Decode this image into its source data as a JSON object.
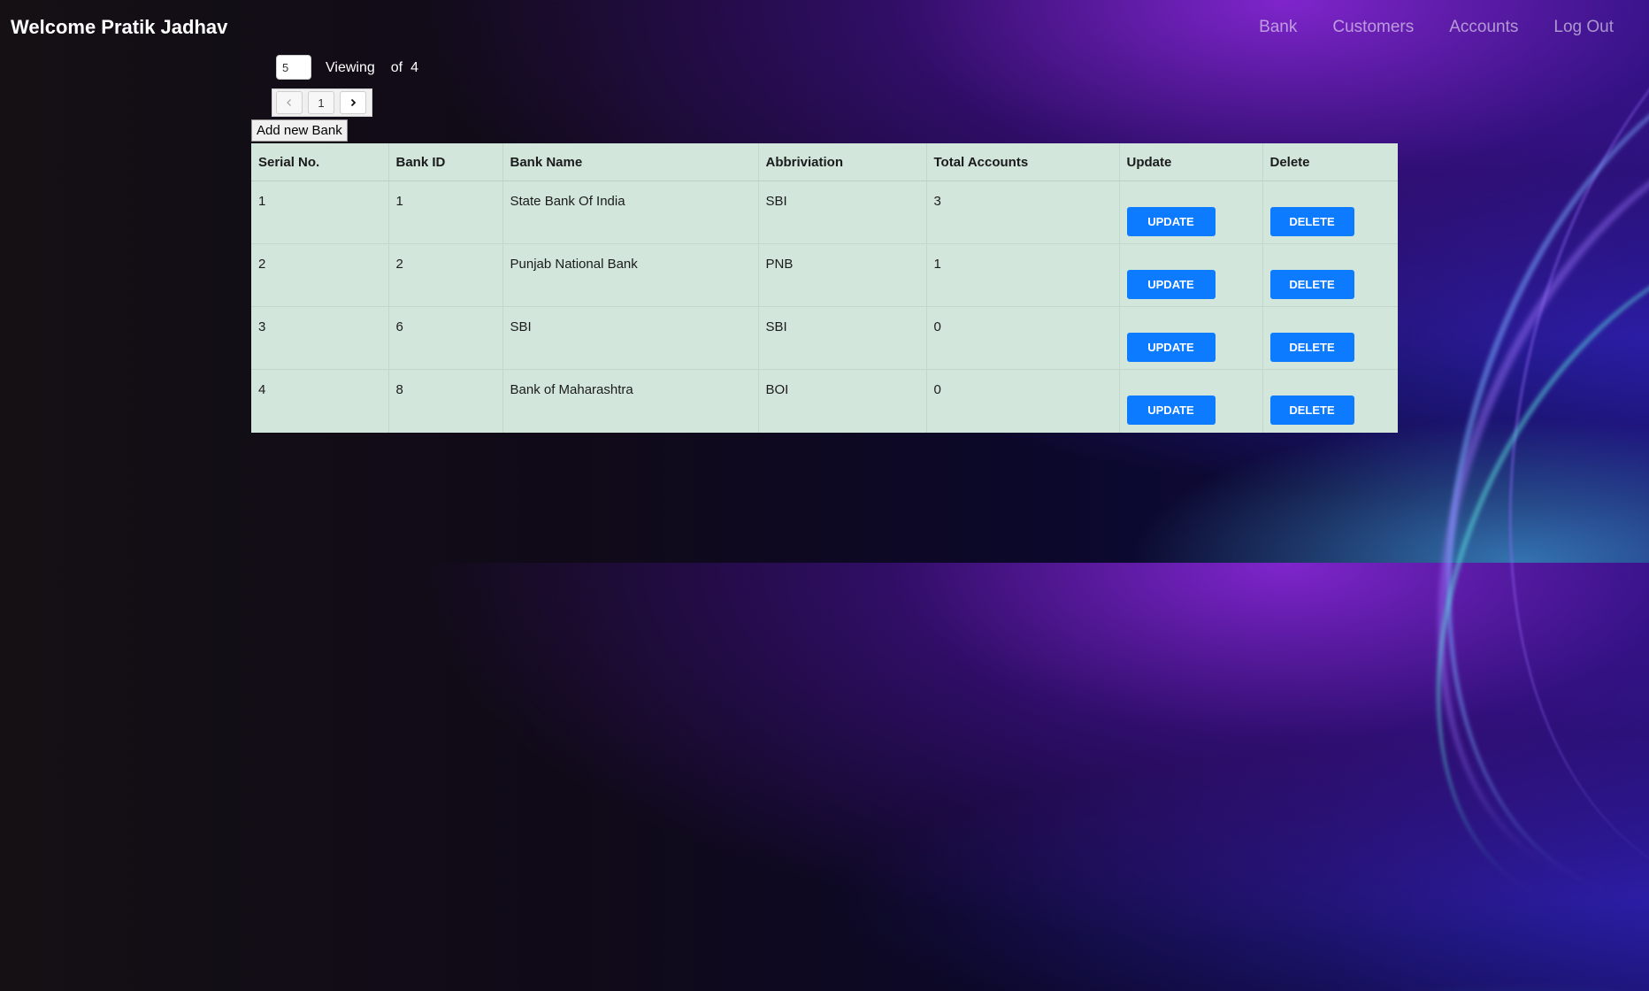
{
  "header": {
    "welcome": "Welcome Pratik Jadhav",
    "nav": [
      {
        "label": "Bank"
      },
      {
        "label": "Customers"
      },
      {
        "label": "Accounts"
      },
      {
        "label": "Log Out"
      }
    ]
  },
  "pagination": {
    "page_size": "5",
    "viewing_label": "Viewing",
    "of_label": "of",
    "total": "4",
    "current_page": "1",
    "prev_icon": "chevron-left-icon",
    "next_icon": "chevron-right-icon"
  },
  "actions": {
    "add_bank_label": "Add new Bank"
  },
  "table": {
    "headers": [
      "Serial No.",
      "Bank ID",
      "Bank Name",
      "Abbriviation",
      "Total Accounts",
      "Update",
      "Delete"
    ],
    "rows": [
      {
        "serial": "1",
        "bank_id": "1",
        "name": "State Bank Of India",
        "abbr": "SBI",
        "total": "3",
        "update": "UPDATE",
        "delete": "DELETE"
      },
      {
        "serial": "2",
        "bank_id": "2",
        "name": "Punjab National Bank",
        "abbr": "PNB",
        "total": "1",
        "update": "UPDATE",
        "delete": "DELETE"
      },
      {
        "serial": "3",
        "bank_id": "6",
        "name": "SBI",
        "abbr": "SBI",
        "total": "0",
        "update": "UPDATE",
        "delete": "DELETE"
      },
      {
        "serial": "4",
        "bank_id": "8",
        "name": "Bank of Maharashtra",
        "abbr": "BOI",
        "total": "0",
        "update": "UPDATE",
        "delete": "DELETE"
      }
    ]
  },
  "colors": {
    "table_bg": "#d2e6dc",
    "button_primary": "#0d7bff",
    "nav_text": "#8c8c9c"
  }
}
